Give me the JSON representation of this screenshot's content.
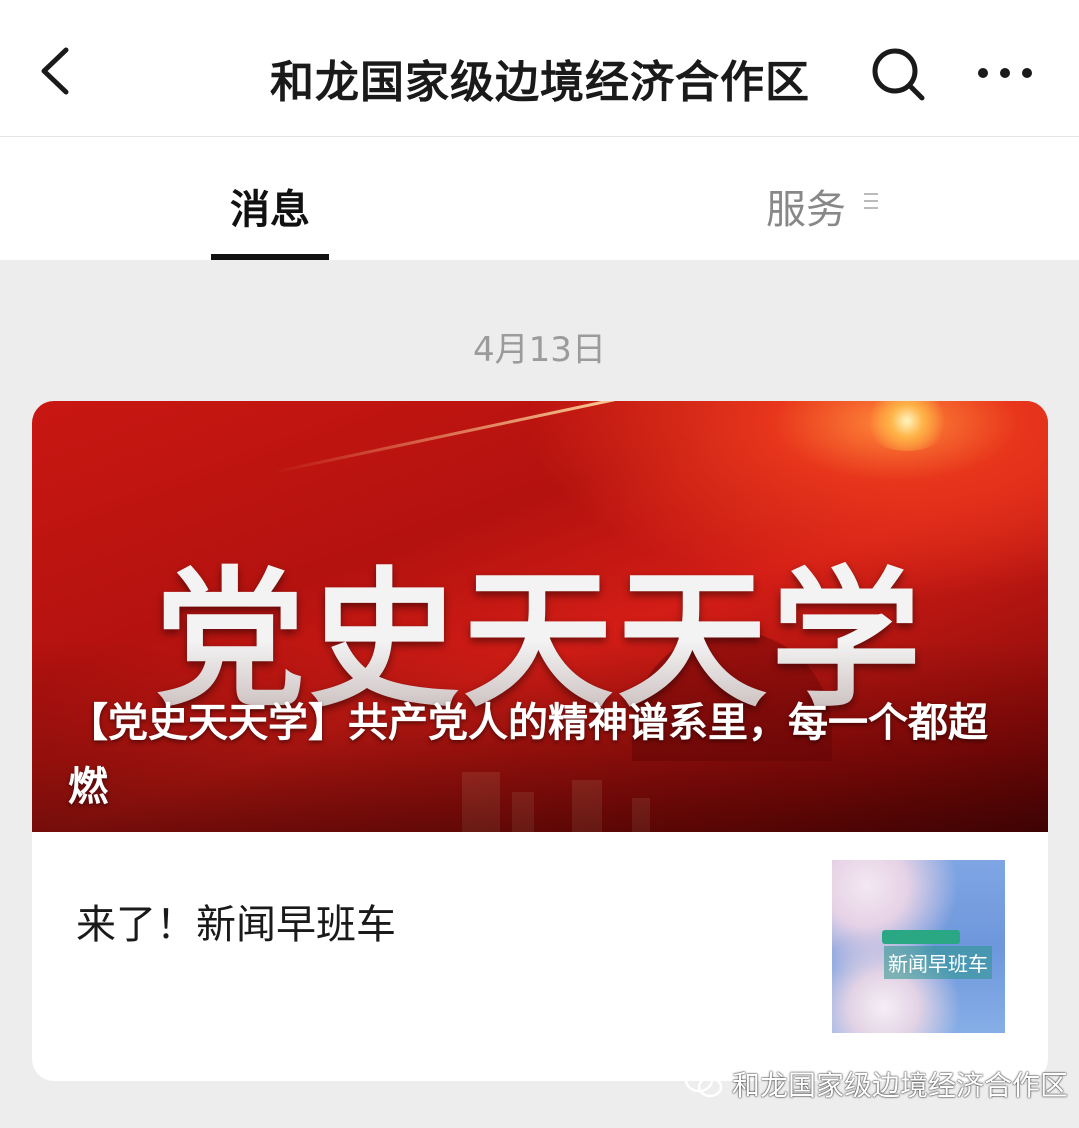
{
  "header": {
    "title": "和龙国家级边境经济合作区",
    "back_icon": "chevron-left-icon",
    "search_icon": "search-icon",
    "more_icon": "more-horizontal-icon"
  },
  "tabs": [
    {
      "label": "消息",
      "active": true
    },
    {
      "label": "服务",
      "active": false
    }
  ],
  "feed": {
    "date": "4月13日",
    "main_article": {
      "banner_text": "党史天天学",
      "headline": "【党史天天学】共产党人的精神谱系里，每一个都超燃"
    },
    "sub_articles": [
      {
        "title": "来了！新闻早班车",
        "thumb_text": "新闻早班车"
      }
    ]
  },
  "watermark": {
    "text": "和龙国家级边境经济合作区"
  },
  "colors": {
    "banner_red": "#c91712",
    "background": "#ededed"
  }
}
